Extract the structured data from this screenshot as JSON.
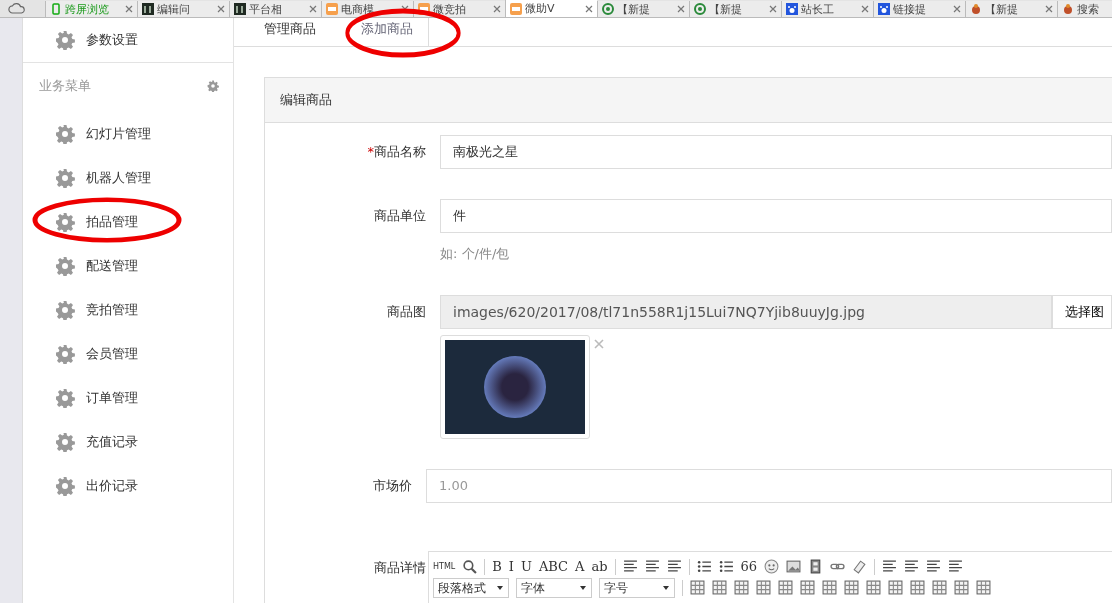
{
  "browser_tabs": [
    {
      "label": "跨屏浏览",
      "selected": false,
      "kind": "phone"
    },
    {
      "label": "编辑问",
      "selected": false,
      "kind": "thumb"
    },
    {
      "label": "平台相",
      "selected": false,
      "kind": "thumb"
    },
    {
      "label": "电商模",
      "selected": false,
      "kind": "logo"
    },
    {
      "label": "微竞拍",
      "selected": false,
      "kind": "logo"
    },
    {
      "label": "微助V",
      "selected": true,
      "kind": "logo"
    },
    {
      "label": "【新提",
      "selected": false,
      "kind": "swirl"
    },
    {
      "label": "【新提",
      "selected": false,
      "kind": "swirl"
    },
    {
      "label": "站长工",
      "selected": false,
      "kind": "paw"
    },
    {
      "label": "链接提",
      "selected": false,
      "kind": "paw"
    },
    {
      "label": "【新提",
      "selected": false,
      "kind": "bug"
    },
    {
      "label": "搜索",
      "selected": false,
      "kind": "bug"
    }
  ],
  "sidebar": {
    "top_item": "参数设置",
    "section_title": "业务菜单",
    "items": [
      "幻灯片管理",
      "机器人管理",
      "拍品管理",
      "配送管理",
      "竞拍管理",
      "会员管理",
      "订单管理",
      "充值记录",
      "出价记录"
    ]
  },
  "tabs": [
    {
      "label": "管理商品",
      "selected": false
    },
    {
      "label": "添加商品",
      "selected": true
    }
  ],
  "panel": {
    "title": "编辑商品",
    "fields": [
      {
        "kind": "text",
        "label": "商品名称",
        "required_mark": "*",
        "value": "南极光之星"
      },
      {
        "kind": "text",
        "label": "商品单位",
        "value": "件",
        "help": "如: 个/件/包"
      },
      {
        "kind": "image",
        "label": "商品图",
        "value": "images/620/2017/08/tl71n558R1j15Lui7NQ7Yjib8uuyJg.jpg",
        "button": "选择图"
      },
      {
        "kind": "price",
        "label": "市场价",
        "placeholder": "1.00"
      },
      {
        "kind": "editor",
        "label": "商品详情",
        "toolbar_row1": [
          {
            "kind": "text",
            "label": "HTML"
          },
          {
            "kind": "search"
          },
          {
            "kind": "sep"
          },
          {
            "kind": "text",
            "label": "B"
          },
          {
            "kind": "text",
            "label": "I"
          },
          {
            "kind": "text",
            "label": "U"
          },
          {
            "kind": "text",
            "label": "ABC"
          },
          {
            "kind": "text",
            "label": "A"
          },
          {
            "kind": "text",
            "label": "ab"
          },
          {
            "kind": "sep"
          },
          {
            "kind": "lines"
          },
          {
            "kind": "lines"
          },
          {
            "kind": "lines"
          },
          {
            "kind": "sep"
          },
          {
            "kind": "list"
          },
          {
            "kind": "list"
          },
          {
            "kind": "text",
            "label": "66"
          },
          {
            "kind": "smiley"
          },
          {
            "kind": "image"
          },
          {
            "kind": "film"
          },
          {
            "kind": "link"
          },
          {
            "kind": "eraser"
          },
          {
            "kind": "sep"
          },
          {
            "kind": "lines"
          },
          {
            "kind": "lines"
          },
          {
            "kind": "lines"
          },
          {
            "kind": "lines"
          }
        ],
        "selects": [
          "段落格式",
          "字体",
          "字号"
        ],
        "toolbar_row2": [
          {
            "kind": "table"
          },
          {
            "kind": "table"
          },
          {
            "kind": "table"
          },
          {
            "kind": "table"
          },
          {
            "kind": "table"
          },
          {
            "kind": "table"
          },
          {
            "kind": "table"
          },
          {
            "kind": "table"
          },
          {
            "kind": "table"
          },
          {
            "kind": "table"
          },
          {
            "kind": "table"
          },
          {
            "kind": "table"
          },
          {
            "kind": "table"
          },
          {
            "kind": "table"
          }
        ]
      }
    ]
  },
  "annotations": [
    {
      "kind": "ellipse"
    },
    {
      "kind": "ellipse"
    }
  ]
}
